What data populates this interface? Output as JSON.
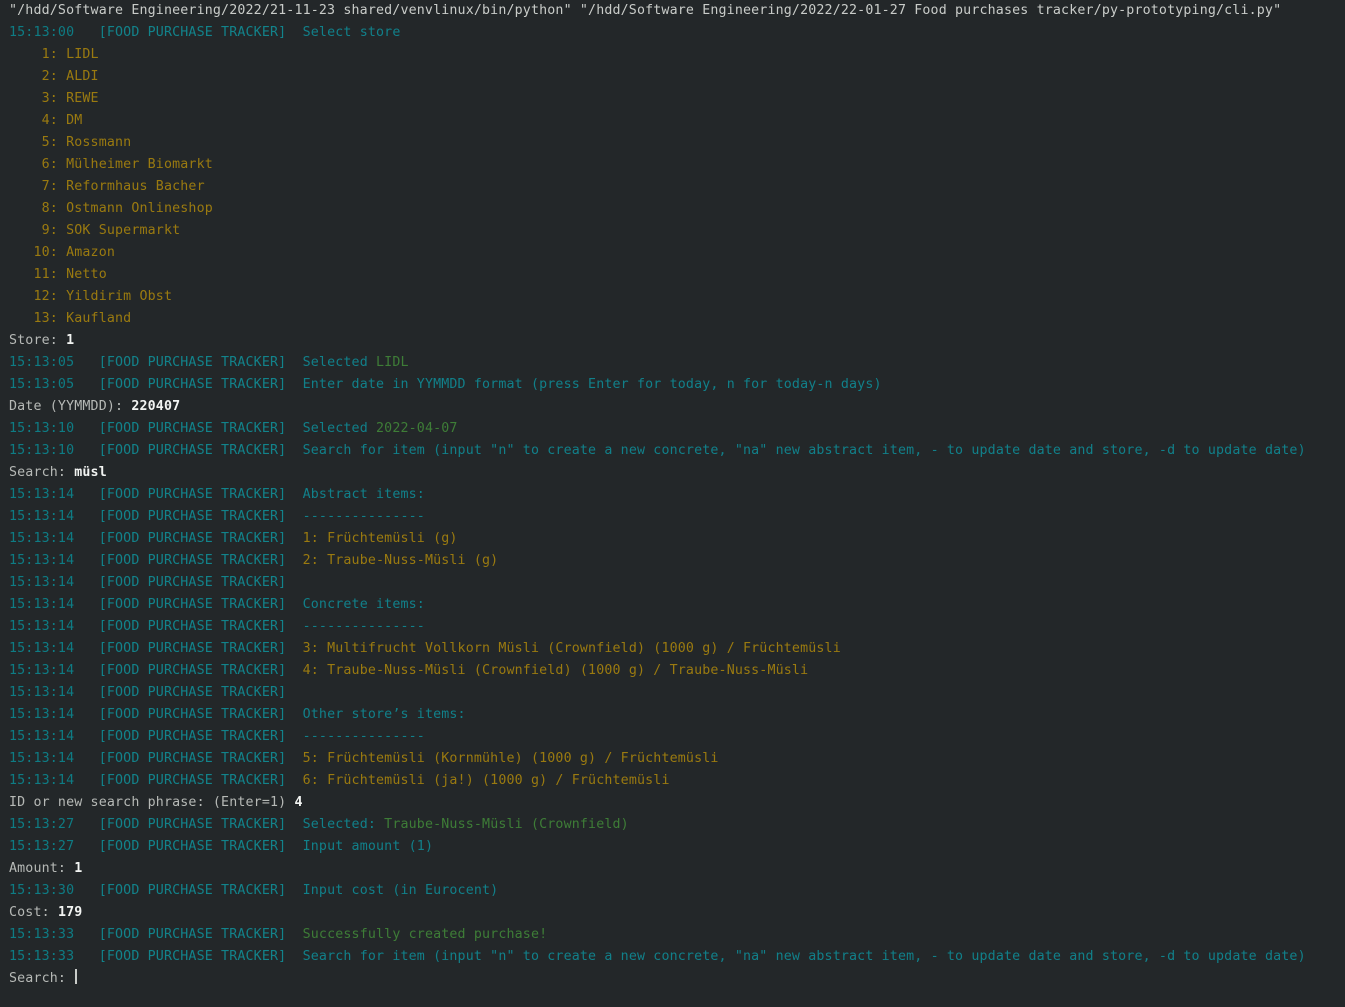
{
  "terminal": {
    "background_color": "#232729",
    "colors": {
      "command": "#c9ccc9",
      "timestamp": "#0e7c84",
      "tag": "#12838b",
      "message": "#11808a",
      "item": "#9a7a10",
      "success": "#3e7d37",
      "prompt": "#b6b9b6",
      "input": "#f2f4f2"
    },
    "log_tag": "[FOOD PURCHASE TRACKER]",
    "command_line": "\"/hdd/Software Engineering/2022/21-11-23 shared/venvlinux/bin/python\" \"/hdd/Software Engineering/2022/22-01-27 Food purchases tracker/py-prototyping/cli.py\"",
    "lines": [
      {
        "kind": "command",
        "text": "\"/hdd/Software Engineering/2022/21-11-23 shared/venvlinux/bin/python\" \"/hdd/Software Engineering/2022/22-01-27 Food purchases tracker/py-prototyping/cli.py\""
      },
      {
        "kind": "log",
        "time": "15:13:00",
        "tag": "[FOOD PURCHASE TRACKER]",
        "message": "Select store"
      },
      {
        "kind": "item",
        "text": "    1: LIDL"
      },
      {
        "kind": "item",
        "text": "    2: ALDI"
      },
      {
        "kind": "item",
        "text": "    3: REWE"
      },
      {
        "kind": "item",
        "text": "    4: DM"
      },
      {
        "kind": "item",
        "text": "    5: Rossmann"
      },
      {
        "kind": "item",
        "text": "    6: Mülheimer Biomarkt"
      },
      {
        "kind": "item",
        "text": "    7: Reformhaus Bacher"
      },
      {
        "kind": "item",
        "text": "    8: Ostmann Onlineshop"
      },
      {
        "kind": "item",
        "text": "    9: SOK Supermarkt"
      },
      {
        "kind": "item",
        "text": "   10: Amazon"
      },
      {
        "kind": "item",
        "text": "   11: Netto"
      },
      {
        "kind": "item",
        "text": "   12: Yildirim Obst"
      },
      {
        "kind": "item",
        "text": "   13: Kaufland"
      },
      {
        "kind": "prompt",
        "label": "Store: ",
        "value": "1"
      },
      {
        "kind": "log",
        "time": "15:13:05",
        "tag": "[FOOD PURCHASE TRACKER]",
        "message": "Selected ",
        "value": "LIDL"
      },
      {
        "kind": "log",
        "time": "15:13:05",
        "tag": "[FOOD PURCHASE TRACKER]",
        "message": "Enter date in YYMMDD format (press Enter for today, n for today-n days)"
      },
      {
        "kind": "prompt",
        "label": "Date (YYMMDD): ",
        "value": "220407"
      },
      {
        "kind": "log",
        "time": "15:13:10",
        "tag": "[FOOD PURCHASE TRACKER]",
        "message": "Selected ",
        "value": "2022-04-07"
      },
      {
        "kind": "log",
        "time": "15:13:10",
        "tag": "[FOOD PURCHASE TRACKER]",
        "message": "Search for item (input \"n\" to create a new concrete, \"na\" new abstract item, - to update date and store, -d to update date)"
      },
      {
        "kind": "prompt",
        "label": "Search: ",
        "value": "müsl"
      },
      {
        "kind": "log",
        "time": "15:13:14",
        "tag": "[FOOD PURCHASE TRACKER]",
        "message": "Abstract items:"
      },
      {
        "kind": "log",
        "time": "15:13:14",
        "tag": "[FOOD PURCHASE TRACKER]",
        "message": "---------------"
      },
      {
        "kind": "log-item",
        "time": "15:13:14",
        "tag": "[FOOD PURCHASE TRACKER]",
        "message": "1: Früchtemüsli (g)"
      },
      {
        "kind": "log-item",
        "time": "15:13:14",
        "tag": "[FOOD PURCHASE TRACKER]",
        "message": "2: Traube-Nuss-Müsli (g)"
      },
      {
        "kind": "log",
        "time": "15:13:14",
        "tag": "[FOOD PURCHASE TRACKER]",
        "message": ""
      },
      {
        "kind": "log",
        "time": "15:13:14",
        "tag": "[FOOD PURCHASE TRACKER]",
        "message": "Concrete items:"
      },
      {
        "kind": "log",
        "time": "15:13:14",
        "tag": "[FOOD PURCHASE TRACKER]",
        "message": "---------------"
      },
      {
        "kind": "log-item",
        "time": "15:13:14",
        "tag": "[FOOD PURCHASE TRACKER]",
        "message": "3: Multifrucht Vollkorn Müsli (Crownfield) (1000 g) / Früchtemüsli"
      },
      {
        "kind": "log-item",
        "time": "15:13:14",
        "tag": "[FOOD PURCHASE TRACKER]",
        "message": "4: Traube-Nuss-Müsli (Crownfield) (1000 g) / Traube-Nuss-Müsli"
      },
      {
        "kind": "log",
        "time": "15:13:14",
        "tag": "[FOOD PURCHASE TRACKER]",
        "message": ""
      },
      {
        "kind": "log",
        "time": "15:13:14",
        "tag": "[FOOD PURCHASE TRACKER]",
        "message": "Other store’s items:"
      },
      {
        "kind": "log",
        "time": "15:13:14",
        "tag": "[FOOD PURCHASE TRACKER]",
        "message": "---------------"
      },
      {
        "kind": "log-item",
        "time": "15:13:14",
        "tag": "[FOOD PURCHASE TRACKER]",
        "message": "5: Früchtemüsli (Kornmühle) (1000 g) / Früchtemüsli"
      },
      {
        "kind": "log-item",
        "time": "15:13:14",
        "tag": "[FOOD PURCHASE TRACKER]",
        "message": "6: Früchtemüsli (ja!) (1000 g) / Früchtemüsli"
      },
      {
        "kind": "prompt",
        "label": "ID or new search phrase: (Enter=1) ",
        "value": "4"
      },
      {
        "kind": "log",
        "time": "15:13:27",
        "tag": "[FOOD PURCHASE TRACKER]",
        "message": "Selected: ",
        "value": "Traube-Nuss-Müsli (Crownfield)"
      },
      {
        "kind": "log",
        "time": "15:13:27",
        "tag": "[FOOD PURCHASE TRACKER]",
        "message": "Input amount (1)"
      },
      {
        "kind": "prompt",
        "label": "Amount: ",
        "value": "1"
      },
      {
        "kind": "log",
        "time": "15:13:30",
        "tag": "[FOOD PURCHASE TRACKER]",
        "message": "Input cost (in Eurocent)"
      },
      {
        "kind": "prompt",
        "label": "Cost: ",
        "value": "179"
      },
      {
        "kind": "log-ok",
        "time": "15:13:33",
        "tag": "[FOOD PURCHASE TRACKER]",
        "message": "Successfully created purchase!"
      },
      {
        "kind": "log",
        "time": "15:13:33",
        "tag": "[FOOD PURCHASE TRACKER]",
        "message": "Search for item (input \"n\" to create a new concrete, \"na\" new abstract item, - to update date and store, -d to update date)"
      },
      {
        "kind": "prompt-cursor",
        "label": "Search: ",
        "value": ""
      }
    ]
  }
}
